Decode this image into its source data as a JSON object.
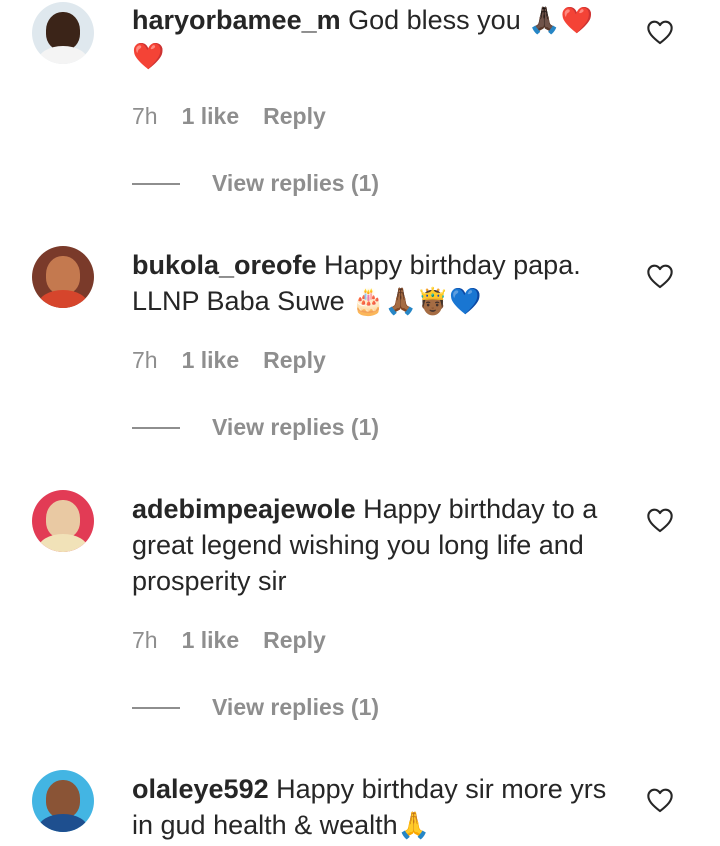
{
  "comments": [
    {
      "username": "haryorbamee_m",
      "text": " God bless you ",
      "emojis": "🙏🏿❤️❤️",
      "time": "7h",
      "likes": "1 like",
      "reply": "Reply",
      "view_replies": "View replies (1)"
    },
    {
      "username": "bukola_oreofe",
      "text": " Happy birthday papa. LLNP Baba Suwe ",
      "emojis": "🎂🙏🏾🤴🏾💙",
      "time": "7h",
      "likes": "1 like",
      "reply": "Reply",
      "view_replies": "View replies (1)"
    },
    {
      "username": "adebimpeajewole",
      "text": " Happy birthday to a great legend wishing you long life and prosperity sir",
      "time": "7h",
      "likes": "1 like",
      "reply": "Reply",
      "view_replies": "View replies (1)"
    },
    {
      "username": "olaleye592",
      "text": " Happy birthday sir more yrs in gud health & wealth",
      "emojis": "🙏"
    }
  ],
  "icons": {
    "like": "heart-outline-icon"
  },
  "colors": {
    "text": "#262626",
    "muted": "#8e8e8e",
    "background": "#ffffff"
  }
}
